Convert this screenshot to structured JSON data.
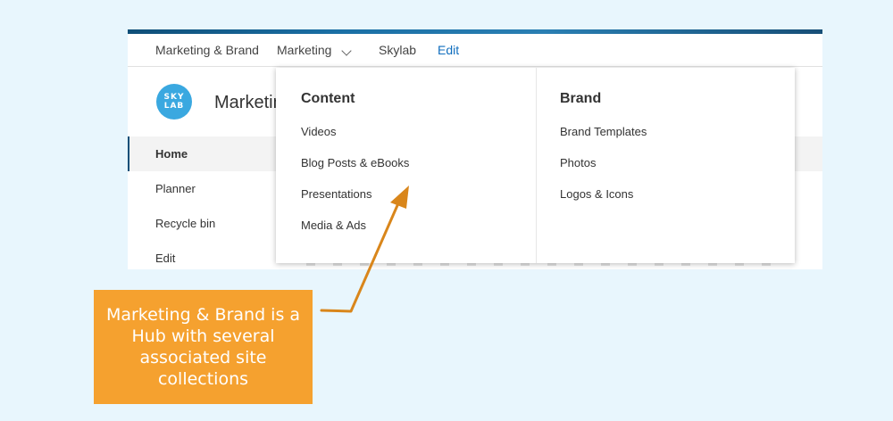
{
  "hub_nav": {
    "items": [
      {
        "label": "Marketing & Brand"
      },
      {
        "label": "Marketing"
      },
      {
        "label": "Skylab"
      },
      {
        "label": "Edit"
      }
    ]
  },
  "site": {
    "logo_text_top": "SKY",
    "logo_text_bottom": "LAB",
    "title": "Marketing"
  },
  "left_nav": {
    "items": [
      {
        "label": "Home"
      },
      {
        "label": "Planner"
      },
      {
        "label": "Recycle bin"
      },
      {
        "label": "Edit"
      }
    ]
  },
  "mega_menu": {
    "columns": [
      {
        "heading": "Content",
        "links": [
          "Videos",
          "Blog Posts & eBooks",
          "Presentations",
          "Media & Ads"
        ]
      },
      {
        "heading": "Brand",
        "links": [
          "Brand Templates",
          "Photos",
          "Logos & Icons"
        ]
      }
    ]
  },
  "callout": {
    "text": "Marketing & Brand is a Hub with several associated site collections"
  },
  "colors": {
    "background": "#e8f6fd",
    "callout": "#f5a12f",
    "arrow": "#d9861b",
    "logo": "#3aa8e0",
    "edit_link": "#106ebe"
  },
  "icons": {
    "dropdown": "chevron-down-icon"
  }
}
